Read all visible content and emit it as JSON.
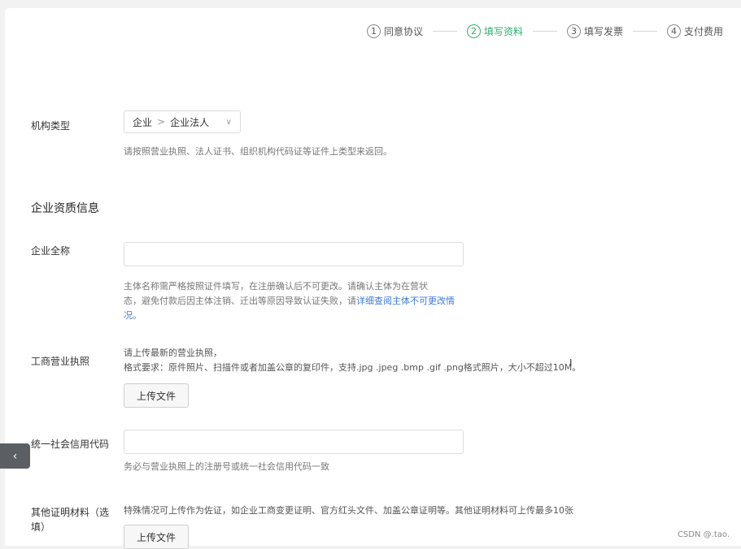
{
  "steps": [
    {
      "num": "1",
      "label": "同意协议"
    },
    {
      "num": "2",
      "label": "填写资料"
    },
    {
      "num": "3",
      "label": "填写发票"
    },
    {
      "num": "4",
      "label": "支付费用"
    }
  ],
  "org_type": {
    "label": "机构类型",
    "select_level1": "企业",
    "select_level2": "企业法人",
    "hint": "请按照营业执照、法人证书、组织机构代码证等证件上类型来返回。"
  },
  "section_title": "企业资质信息",
  "company_name": {
    "label": "企业全称",
    "value": "",
    "hint_line1": "主体名称需严格按照证件填写，在注册确认后不可更改。请确认主体为在营状",
    "hint_line2_prefix": "态，避免付款后因主体注销、迁出等原因导致认证失败，请",
    "hint_link": "详细查阅主体不可更改情况",
    "hint_line3_suffix": "。"
  },
  "business_license": {
    "label": "工商营业执照",
    "hint_line1": "请上传最新的营业执照，",
    "hint_line2": "格式要求：原件照片、扫描件或者加盖公章的复印件，支持.jpg .jpeg .bmp .gif .png格式照片，大小不超过10M。",
    "upload_label": "上传文件"
  },
  "credit_code": {
    "label": "统一社会信用代码",
    "value": "",
    "hint": "务必与营业执照上的注册号或统一社会信用代码一致"
  },
  "other_docs": {
    "label_line1": "其他证明材料（选",
    "label_line2": "填）",
    "hint": "特殊情况可上传作为佐证，如企业工商变更证明、官方红头文件、加盖公章证明等。其他证明材料可上传最多10张",
    "upload_label": "上传文件"
  },
  "watermark": "CSDN @.tao.",
  "colors": {
    "active": "#2fb06b",
    "link": "#3d7bd9"
  }
}
